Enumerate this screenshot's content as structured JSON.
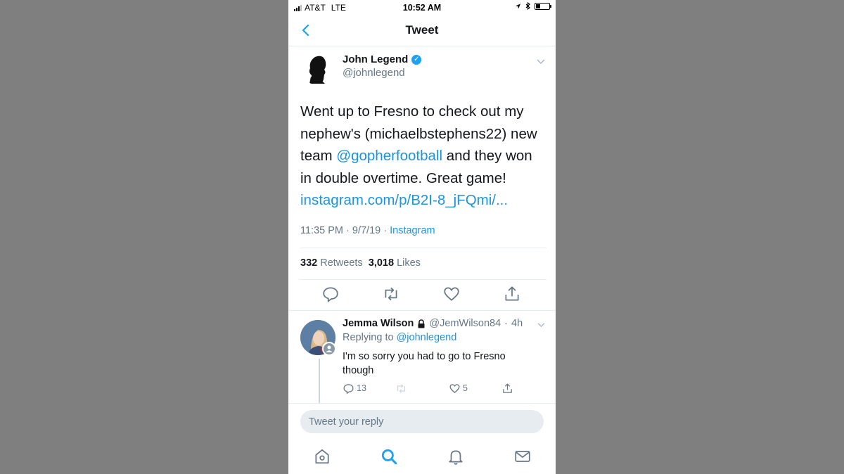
{
  "status_bar": {
    "carrier": "AT&T",
    "network": "LTE",
    "time": "10:52 AM"
  },
  "header": {
    "title": "Tweet"
  },
  "tweet": {
    "author_name": "John Legend",
    "author_handle": "@johnlegend",
    "text_lines": [
      [
        "Went up to Fresno to check out my"
      ],
      [
        "nephew's (michaelbstephens22) new"
      ],
      [
        "team ",
        "@gopherfootball",
        " and they won"
      ],
      [
        "in double overtime. Great game!"
      ],
      [
        "instagram.com/p/B2I-8_jFQmi/..."
      ]
    ],
    "time": "11:35 PM",
    "date": "9/7/19",
    "source": "Instagram",
    "retweets": "332",
    "retweets_label": "Retweets",
    "likes": "3,018",
    "likes_label": "Likes"
  },
  "reply": {
    "name": "Jemma Wilson",
    "handle": "@JemWilson84",
    "age": "4h",
    "replying_prefix": "Replying to",
    "replying_to": "@johnlegend",
    "text": "I'm so sorry you had to go to Fresno though",
    "reply_count": "13",
    "like_count": "5"
  },
  "compose": {
    "placeholder": "Tweet your reply"
  },
  "colors": {
    "accent": "#1b95e0",
    "muted": "#657786",
    "background": "#7f7f7f"
  },
  "icons": [
    "back-icon",
    "verified-icon",
    "chevron-down-icon",
    "reply-icon",
    "retweet-icon",
    "like-icon",
    "share-icon",
    "lock-icon",
    "home-icon",
    "search-icon",
    "notifications-icon",
    "messages-icon"
  ]
}
